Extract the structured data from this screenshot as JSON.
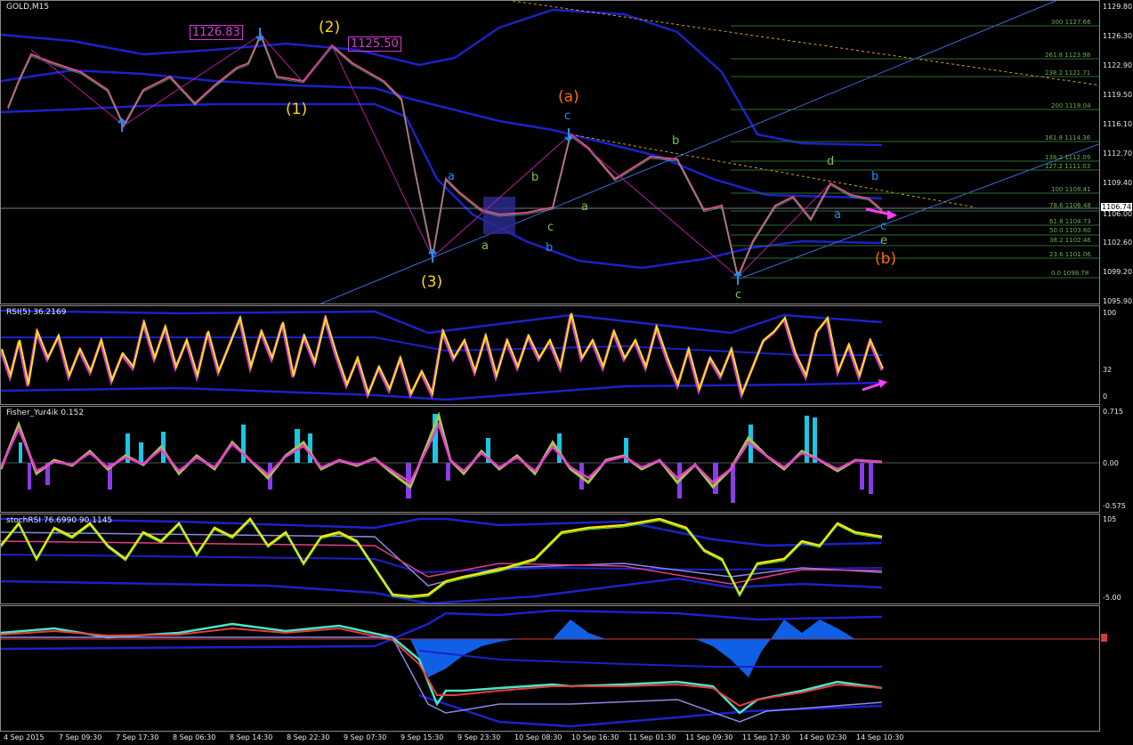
{
  "symbol_title": "GOLD,M15",
  "price_axis": [
    "1129.80",
    "1126.30",
    "1122.90",
    "1119.50",
    "1116.10",
    "1112.70",
    "1109.40",
    "1106.00",
    "1102.60",
    "1099.20",
    "1095.90"
  ],
  "current_price": "1106.74",
  "price_boxes": [
    "1126.83",
    "1125.50"
  ],
  "fib_levels": [
    "300 1127.66",
    "261.8 1123.98",
    "238.2 1121.71",
    "200 1118.04",
    "161.8 1114.36",
    "138.2 1112.09",
    "127.2 1111.03",
    "100 1108.41",
    "78.6 1106.48",
    "61.8 1104.73",
    "50.0 1103.60",
    "38.2 1102.46",
    "23.6 1101.06",
    "0.0 1098.78"
  ],
  "wave_labels": {
    "w1": "(1)",
    "w2": "(2)",
    "w3": "(3)",
    "wa_big": "(a)",
    "wb_big": "(b)",
    "c_blue_top": "c",
    "a1": "a",
    "b1": "b",
    "a2": "a",
    "b2": "b",
    "c1": "c",
    "a3": "a",
    "b3": "b",
    "c2": "c",
    "d1": "d",
    "a4": "a",
    "b4": "b",
    "c3": "c",
    "e1": "e"
  },
  "rsi": {
    "title": "RSI(5) 36.2169",
    "axis": [
      "100",
      "32",
      "0"
    ]
  },
  "fisher": {
    "title": "Fisher_Yur4ik 0.152",
    "axis": [
      "0.715",
      "0.00",
      "-0.575"
    ]
  },
  "stoch": {
    "title": "stochRSI 76.6990 90.1145",
    "axis": [
      "105",
      "-5.00"
    ]
  },
  "time_axis": [
    "4 Sep 2015",
    "7 Sep 09:30",
    "7 Sep 17:30",
    "8 Sep 06:30",
    "8 Sep 14:30",
    "8 Sep 22:30",
    "9 Sep 07:30",
    "9 Sep 15:30",
    "9 Sep 23:30",
    "10 Sep 08:30",
    "10 Sep 16:30",
    "11 Sep 01:30",
    "11 Sep 09:30",
    "11 Sep 17:30",
    "14 Sep 02:30",
    "14 Sep 10:30"
  ],
  "colors": {
    "yellow": "#ffd700",
    "magenta": "#d23cd2",
    "blue": "#1a22c8",
    "fib_green": "#6ab04c",
    "orange": "#ff6a00",
    "cyan_blue": "#1e90ff"
  }
}
